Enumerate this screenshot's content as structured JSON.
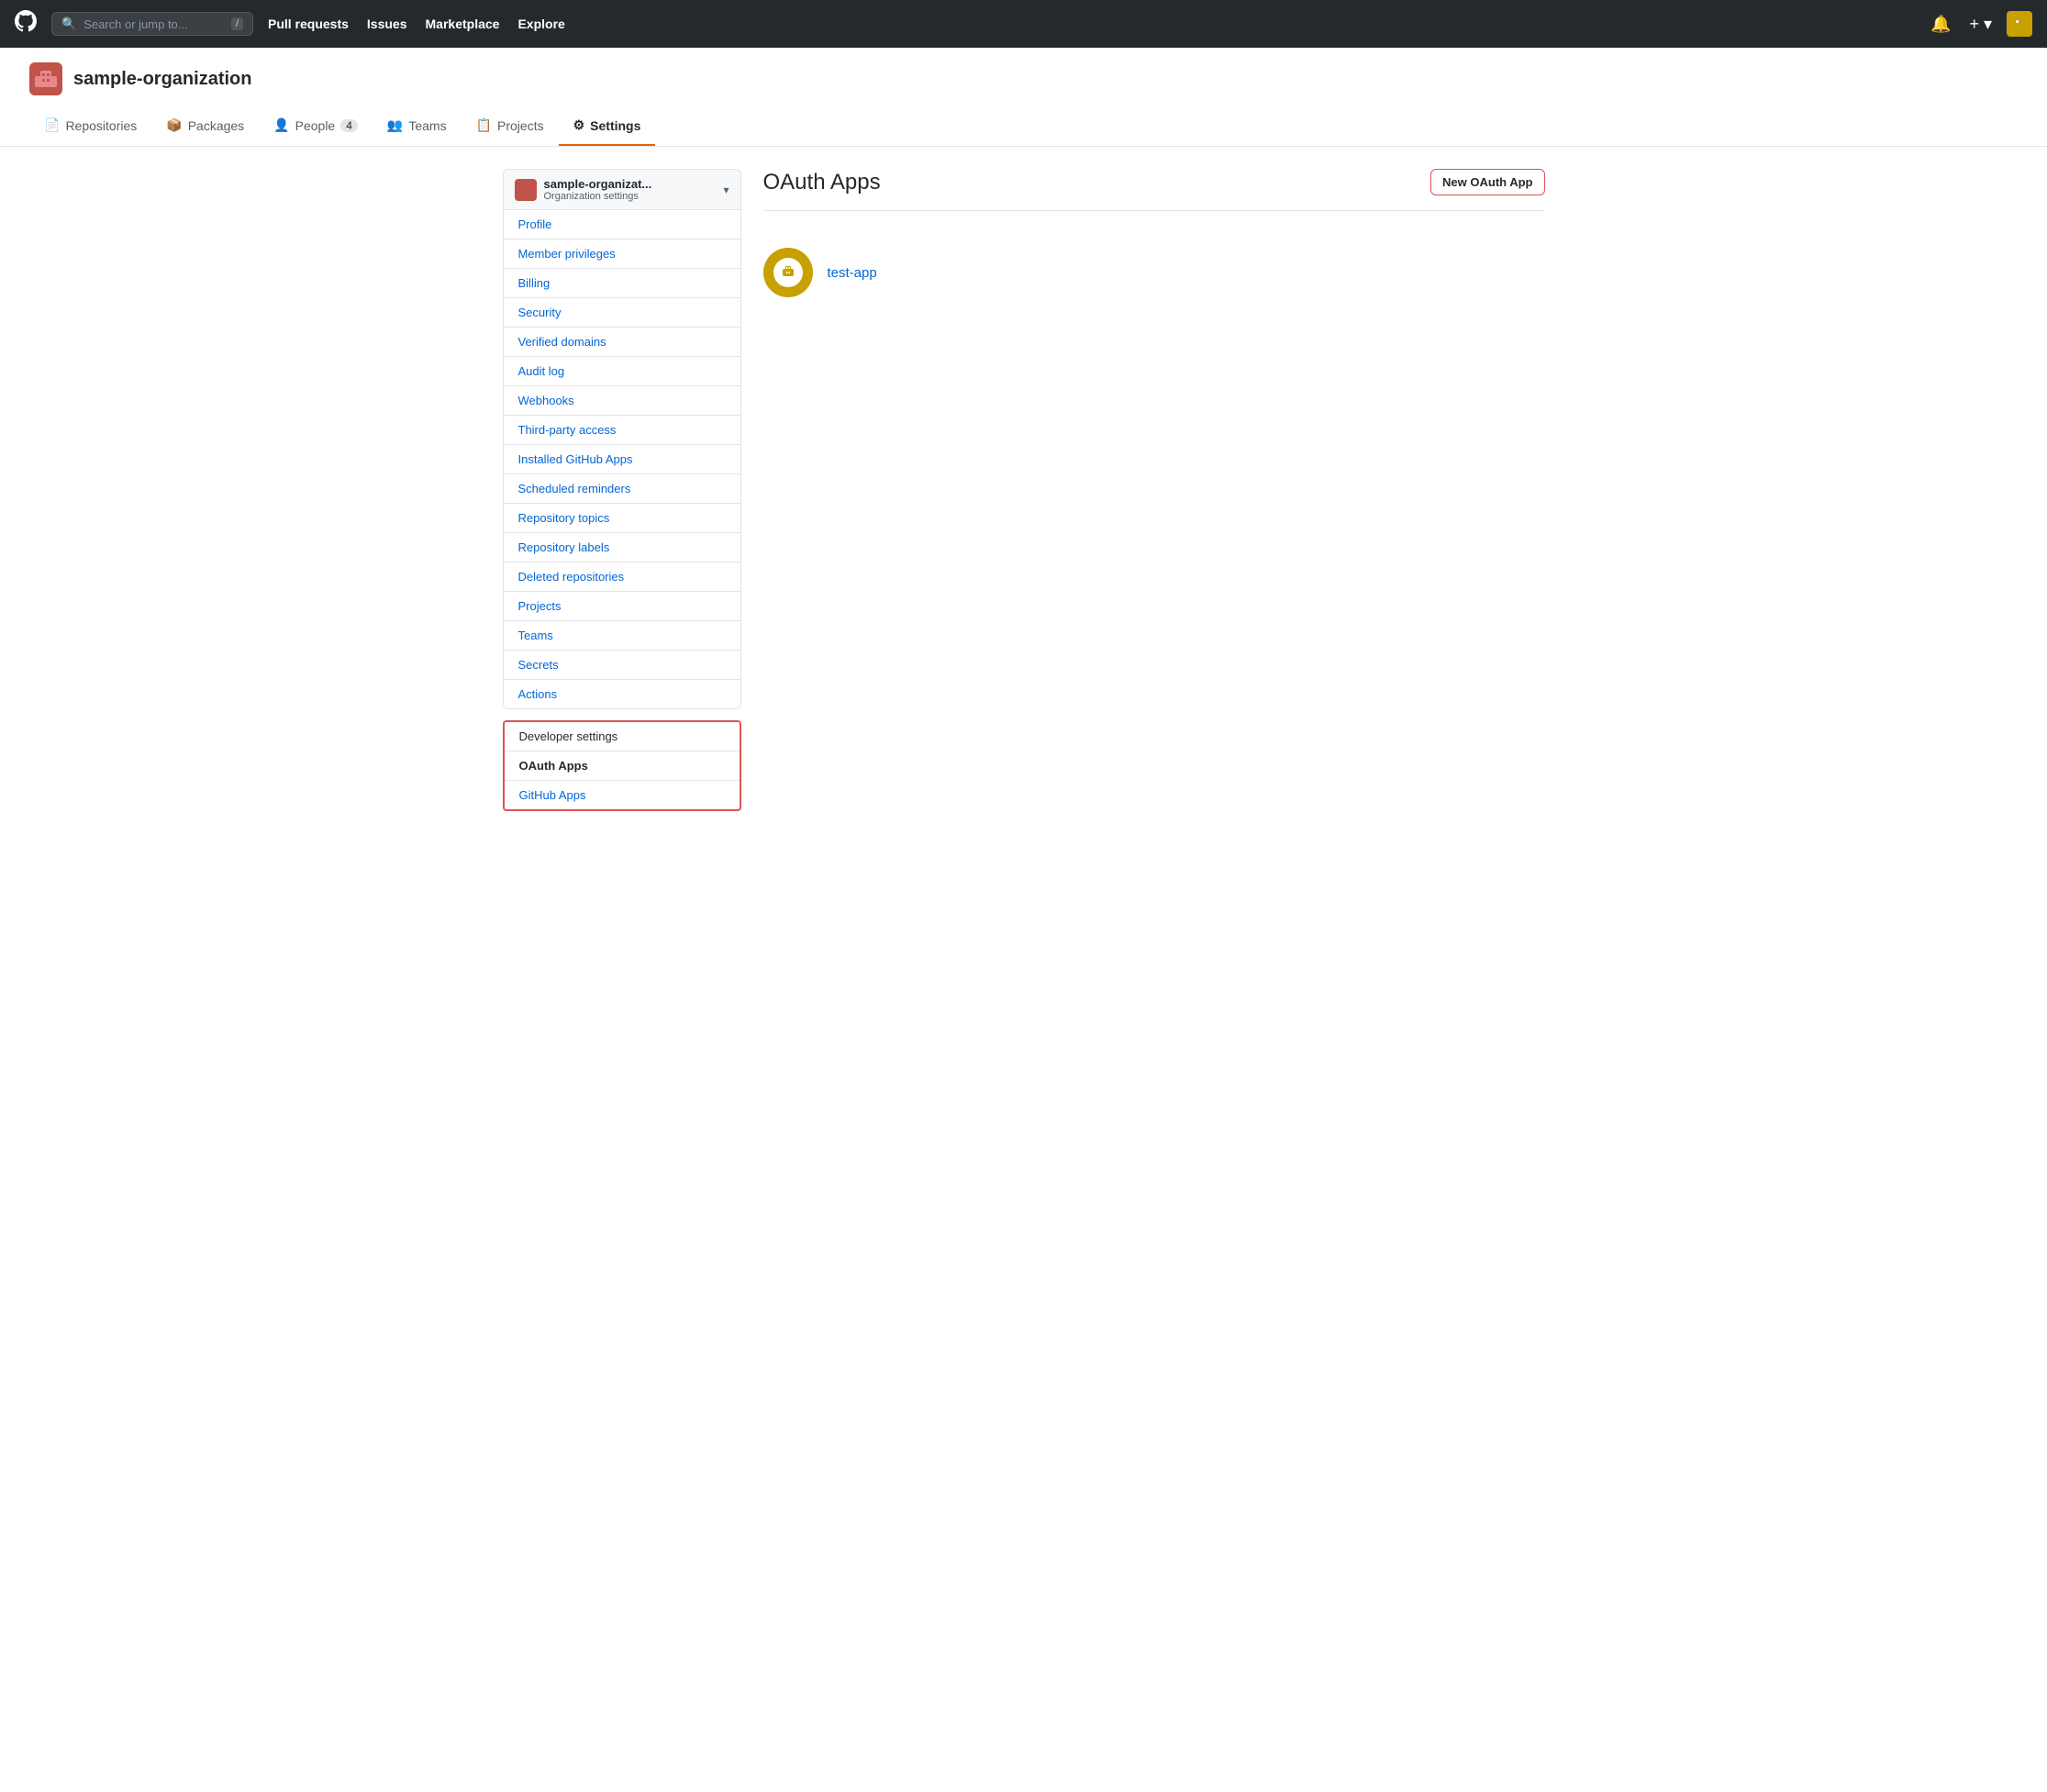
{
  "topnav": {
    "logo_label": "GitHub",
    "search_placeholder": "Search or jump to...",
    "search_kbd": "/",
    "links": [
      {
        "label": "Pull requests",
        "href": "#"
      },
      {
        "label": "Issues",
        "href": "#"
      },
      {
        "label": "Marketplace",
        "href": "#"
      },
      {
        "label": "Explore",
        "href": "#"
      }
    ],
    "notification_icon": "🔔",
    "plus_icon": "+",
    "avatar_label": "avatar"
  },
  "org": {
    "name": "sample-organization",
    "tabs": [
      {
        "label": "Repositories",
        "icon": "📄",
        "active": false
      },
      {
        "label": "Packages",
        "icon": "📦",
        "active": false
      },
      {
        "label": "People",
        "icon": "👤",
        "badge": "4",
        "active": false
      },
      {
        "label": "Teams",
        "icon": "👥",
        "active": false
      },
      {
        "label": "Projects",
        "icon": "📋",
        "active": false
      },
      {
        "label": "Settings",
        "icon": "⚙",
        "active": true
      }
    ]
  },
  "sidebar": {
    "org_name": "sample-organizat...",
    "org_sub": "Organization settings",
    "nav_items": [
      {
        "label": "Profile"
      },
      {
        "label": "Member privileges"
      },
      {
        "label": "Billing"
      },
      {
        "label": "Security"
      },
      {
        "label": "Verified domains"
      },
      {
        "label": "Audit log"
      },
      {
        "label": "Webhooks"
      },
      {
        "label": "Third-party access"
      },
      {
        "label": "Installed GitHub Apps"
      },
      {
        "label": "Scheduled reminders"
      },
      {
        "label": "Repository topics"
      },
      {
        "label": "Repository labels"
      },
      {
        "label": "Deleted repositories"
      },
      {
        "label": "Projects"
      },
      {
        "label": "Teams"
      },
      {
        "label": "Secrets"
      },
      {
        "label": "Actions"
      }
    ],
    "developer_settings": {
      "section_label": "Developer settings",
      "active_item": "OAuth Apps",
      "sub_items": [
        {
          "label": "GitHub Apps"
        }
      ]
    }
  },
  "content": {
    "title": "OAuth Apps",
    "new_button_label": "New OAuth App",
    "apps": [
      {
        "name": "test-app",
        "avatar_color": "#c8a000"
      }
    ]
  }
}
